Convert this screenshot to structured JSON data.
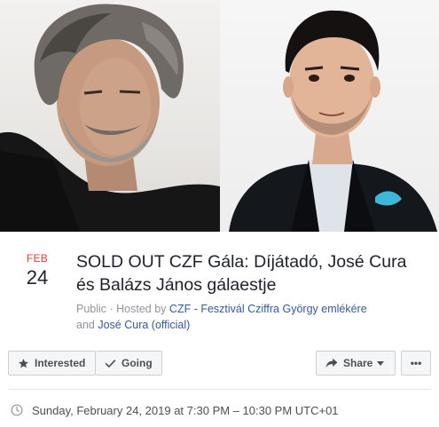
{
  "event": {
    "date": {
      "month": "FEB",
      "day": "24"
    },
    "title": "SOLD OUT CZF Gála: Díjátadó, José Cura és Balázs János gálaestje",
    "meta": {
      "privacy": "Public",
      "separator": " · ",
      "hosted_by": "Hosted by ",
      "host1": "CZF - Fesztivál Cziffra György emlékére",
      "and": " and ",
      "host2": "José Cura (official)"
    },
    "datetime": "Sunday, February 24, 2019 at 7:30 PM – 10:30 PM UTC+01"
  },
  "actions": {
    "interested": "Interested",
    "going": "Going",
    "share": "Share",
    "more": "•••"
  },
  "colors": {
    "month_accent": "#e0393e",
    "link": "#365899",
    "button_bg": "#f5f6f7",
    "button_border": "#ccd0d5"
  },
  "icons": {
    "interested": "star-icon",
    "going": "checkmark-icon",
    "share": "share-arrow-icon",
    "share_dropdown": "caret-down-icon",
    "time": "clock-icon"
  }
}
